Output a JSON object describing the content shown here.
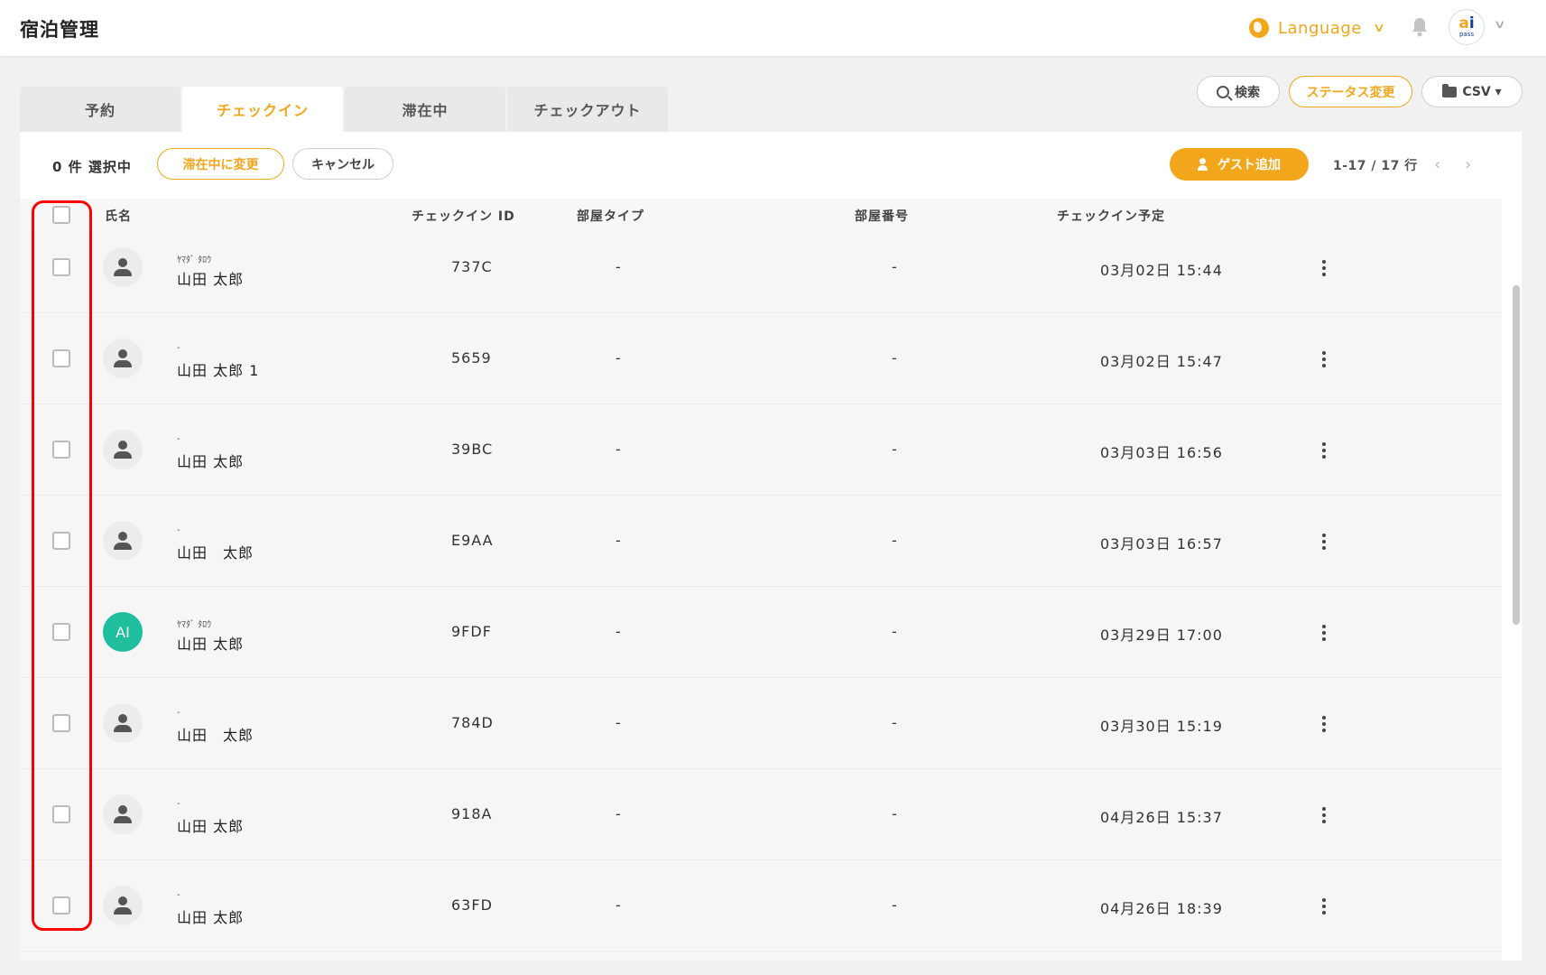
{
  "app": {
    "title": "宿泊管理"
  },
  "header": {
    "language_label": "Language",
    "logo_text_a": "a",
    "logo_text_i": "i",
    "logo_sub": "pass"
  },
  "tabs": [
    {
      "label": "予約"
    },
    {
      "label": "チェックイン",
      "active": true
    },
    {
      "label": "滞在中"
    },
    {
      "label": "チェックアウト"
    }
  ],
  "actions": {
    "search_label": "検索",
    "status_label": "ステータス変更",
    "csv_label": "CSV ▾"
  },
  "toolbar": {
    "selection": "0 件 選択中",
    "stay_button": "滞在中に変更",
    "cancel_button": "キャンセル",
    "add_guest_button": "ゲスト追加",
    "pager": "1-17 / 17 行",
    "prev": "‹",
    "next": "›"
  },
  "table": {
    "columns": {
      "name": "氏名",
      "checkin_id": "チェックイン ID",
      "room_type": "部屋タイプ",
      "room_number": "部屋番号",
      "checkin_time": "チェックイン予定"
    },
    "rows": [
      {
        "kana": "ﾔﾏﾀﾞ ﾀﾛｳ",
        "name": "山田 太郎",
        "id": "737C",
        "room_type": "-",
        "room_number": "-",
        "time": "03月02日 15:44",
        "avatar": "person"
      },
      {
        "kana": "-",
        "name": "山田 太郎 1",
        "id": "5659",
        "room_type": "-",
        "room_number": "-",
        "time": "03月02日 15:47",
        "avatar": "person"
      },
      {
        "kana": "-",
        "name": "山田 太郎",
        "id": "39BC",
        "room_type": "-",
        "room_number": "-",
        "time": "03月03日 16:56",
        "avatar": "person"
      },
      {
        "kana": "-",
        "name": "山田　太郎",
        "id": "E9AA",
        "room_type": "-",
        "room_number": "-",
        "time": "03月03日 16:57",
        "avatar": "person"
      },
      {
        "kana": "ﾔﾏﾀﾞ ﾀﾛｳ",
        "name": "山田 太郎",
        "id": "9FDF",
        "room_type": "-",
        "room_number": "-",
        "time": "03月29日 17:00",
        "avatar": "AI"
      },
      {
        "kana": "-",
        "name": "山田　太郎",
        "id": "784D",
        "room_type": "-",
        "room_number": "-",
        "time": "03月30日 15:19",
        "avatar": "person"
      },
      {
        "kana": "-",
        "name": "山田 太郎",
        "id": "918A",
        "room_type": "-",
        "room_number": "-",
        "time": "04月26日 15:37",
        "avatar": "person"
      },
      {
        "kana": "-",
        "name": "山田 太郎",
        "id": "63FD",
        "room_type": "-",
        "room_number": "-",
        "time": "04月26日 18:39",
        "avatar": "person"
      }
    ]
  },
  "colors": {
    "accent": "#f2a61b",
    "teal": "#1fbf9e",
    "highlight": "#ff0000"
  }
}
